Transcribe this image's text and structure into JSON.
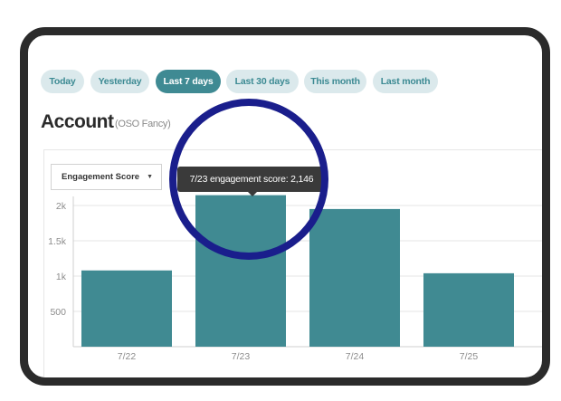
{
  "date_filters": {
    "buttons": [
      {
        "label": "Today",
        "active": false
      },
      {
        "label": "Yesterday",
        "active": false
      },
      {
        "label": "Last 7 days",
        "active": true
      },
      {
        "label": "Last 30 days",
        "active": false
      },
      {
        "label": "This month",
        "active": false
      },
      {
        "label": "Last month",
        "active": false
      }
    ]
  },
  "account": {
    "title": "Account",
    "subtitle": "(OSO Fancy)"
  },
  "metric_select": {
    "value": "Engagement Score",
    "caret": "▼"
  },
  "tooltip": {
    "date": "7/23",
    "text": "engagement score: 2,146"
  },
  "colors": {
    "accent": "#3f8a93",
    "bar": "#408a92",
    "highlight_ring": "#1a1e8c"
  },
  "chart_data": {
    "type": "bar",
    "categories": [
      "7/22",
      "7/23",
      "7/24",
      "7/25"
    ],
    "values": [
      1080,
      2146,
      1950,
      1040
    ],
    "ytick_labels": [
      "500",
      "1k",
      "1.5k",
      "2k"
    ],
    "ytick_values": [
      500,
      1000,
      1500,
      2000
    ],
    "ylim": [
      0,
      2500
    ],
    "grid": true
  }
}
